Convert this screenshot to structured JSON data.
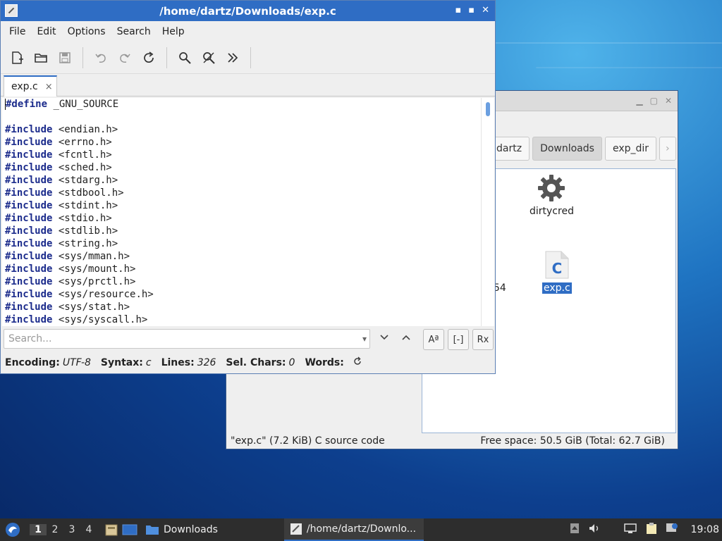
{
  "editor": {
    "title": "/home/dartz/Downloads/exp.c",
    "menu": [
      "File",
      "Edit",
      "Options",
      "Search",
      "Help"
    ],
    "tab_label": "exp.c",
    "tab_close": "×",
    "code": [
      {
        "kw": "#define",
        "rest": " _GNU_SOURCE"
      },
      {
        "kw": "",
        "rest": ""
      },
      {
        "kw": "#include",
        "rest": " <endian.h>"
      },
      {
        "kw": "#include",
        "rest": " <errno.h>"
      },
      {
        "kw": "#include",
        "rest": " <fcntl.h>"
      },
      {
        "kw": "#include",
        "rest": " <sched.h>"
      },
      {
        "kw": "#include",
        "rest": " <stdarg.h>"
      },
      {
        "kw": "#include",
        "rest": " <stdbool.h>"
      },
      {
        "kw": "#include",
        "rest": " <stdint.h>"
      },
      {
        "kw": "#include",
        "rest": " <stdio.h>"
      },
      {
        "kw": "#include",
        "rest": " <stdlib.h>"
      },
      {
        "kw": "#include",
        "rest": " <string.h>"
      },
      {
        "kw": "#include",
        "rest": " <sys/mman.h>"
      },
      {
        "kw": "#include",
        "rest": " <sys/mount.h>"
      },
      {
        "kw": "#include",
        "rest": " <sys/prctl.h>"
      },
      {
        "kw": "#include",
        "rest": " <sys/resource.h>"
      },
      {
        "kw": "#include",
        "rest": " <sys/stat.h>"
      },
      {
        "kw": "#include",
        "rest": " <sys/syscall.h>"
      }
    ],
    "search_placeholder": "Search...",
    "status": {
      "encoding_label": "Encoding:",
      "encoding_value": "UTF-8",
      "syntax_label": "Syntax:",
      "syntax_value": "c",
      "lines_label": "Lines:",
      "lines_value": "326",
      "sel_label": "Sel. Chars:",
      "sel_value": "0",
      "words_label": "Words:"
    }
  },
  "file_manager": {
    "breadcrumbs": [
      "dartz",
      "Downloads",
      "exp_dir"
    ],
    "items": [
      {
        "label": "dirtycred",
        "icon": "gear-icon"
      },
      {
        "label": "exp.c",
        "icon": "c-source-file-icon"
      }
    ],
    "partial_label": "54",
    "status_left": "\"exp.c\" (7.2 KiB) C source code",
    "status_right": "Free space: 50.5 GiB (Total: 62.7 GiB)"
  },
  "taskbar": {
    "desktops": [
      "1",
      "2",
      "3",
      "4"
    ],
    "tasks": [
      {
        "label": "Downloads"
      },
      {
        "label": "/home/dartz/Downlo..."
      }
    ],
    "clock": "19:08"
  }
}
